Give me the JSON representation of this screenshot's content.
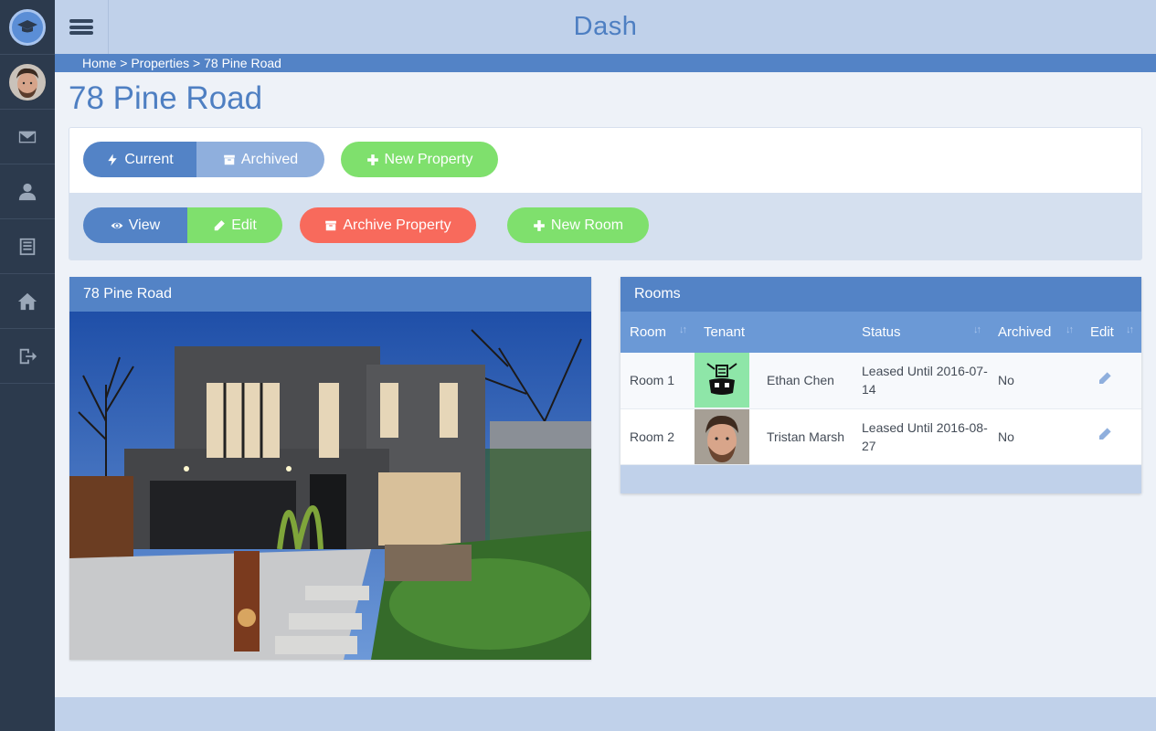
{
  "header": {
    "title": "Dash"
  },
  "breadcrumb": {
    "items": [
      "Home",
      "Properties",
      "78 Pine Road"
    ],
    "separator": ">"
  },
  "page": {
    "title": "78 Pine Road"
  },
  "actions": {
    "current_label": "Current",
    "archived_label": "Archived",
    "new_property_label": "New Property",
    "view_label": "View",
    "edit_label": "Edit",
    "archive_property_label": "Archive Property",
    "new_room_label": "New Room"
  },
  "property_card": {
    "title": "78 Pine Road"
  },
  "rooms": {
    "title": "Rooms",
    "columns": [
      "Room",
      "Tenant",
      "Status",
      "Archived",
      "Edit"
    ],
    "sort_glyph": "↓↑",
    "rows": [
      {
        "room": "Room 1",
        "tenant": "Ethan Chen",
        "status": "Leased Until 2016-07-14",
        "archived": "No",
        "avatar": "robot-avatar"
      },
      {
        "room": "Room 2",
        "tenant": "Tristan Marsh",
        "status": "Leased Until 2016-08-27",
        "archived": "No",
        "avatar": "photo-avatar"
      }
    ]
  },
  "colors": {
    "accent": "#5383c6",
    "sidebar": "#2c3a4d",
    "success": "#7fe06d",
    "danger": "#f86a5c",
    "header": "#c0d1ea"
  },
  "icons": {
    "sidebar": [
      "mail-icon",
      "user-icon",
      "list-icon",
      "home-icon",
      "logout-icon"
    ]
  }
}
